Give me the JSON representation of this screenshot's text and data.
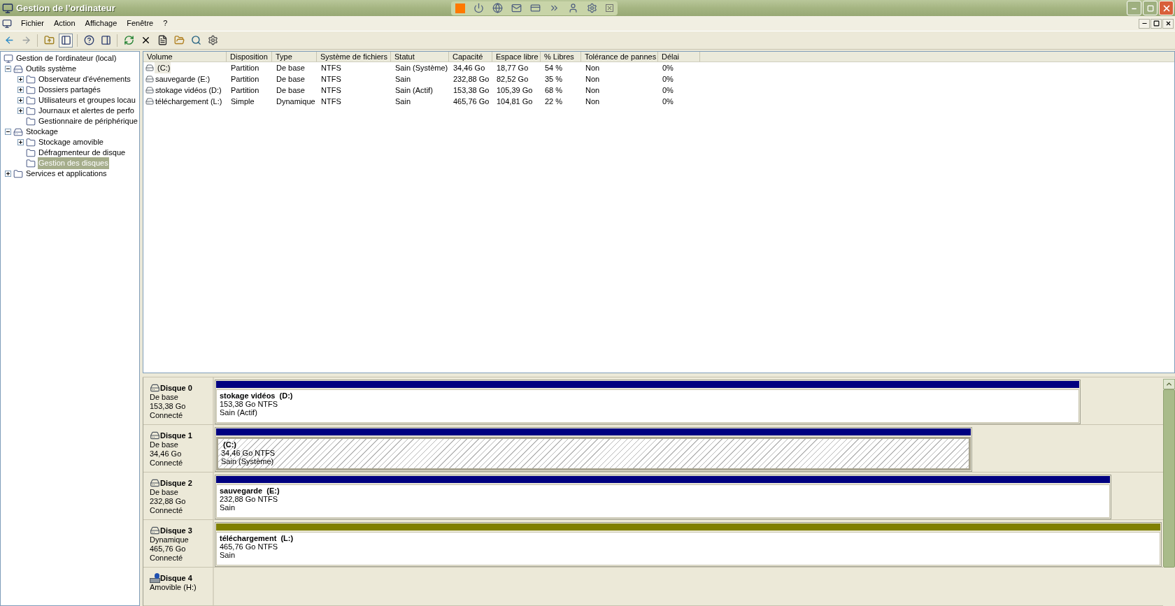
{
  "window": {
    "title": "Gestion de l'ordinateur"
  },
  "menu": [
    "Fichier",
    "Action",
    "Affichage",
    "Fenêtre",
    "?"
  ],
  "tree": [
    {
      "label": "Gestion de l'ordinateur (local)",
      "selected": false,
      "children": [
        {
          "label": "Outils système",
          "expanded": true,
          "selected": false,
          "children": [
            {
              "label": "Observateur d'événements",
              "expanded": false,
              "selected": false
            },
            {
              "label": "Dossiers partagés",
              "expanded": false,
              "selected": false
            },
            {
              "label": "Utilisateurs et groupes locau",
              "expanded": false,
              "selected": false
            },
            {
              "label": "Journaux et alertes de perfo",
              "expanded": false,
              "selected": false
            },
            {
              "label": "Gestionnaire de périphérique",
              "selected": false
            }
          ]
        },
        {
          "label": "Stockage",
          "expanded": true,
          "selected": false,
          "children": [
            {
              "label": "Stockage amovible",
              "expanded": false,
              "selected": false
            },
            {
              "label": "Défragmenteur de disque",
              "selected": false
            },
            {
              "label": "Gestion des disques",
              "selected": true
            }
          ]
        },
        {
          "label": "Services et applications",
          "expanded": false,
          "selected": false
        }
      ]
    }
  ],
  "volumes": {
    "columns": [
      "Volume",
      "Disposition",
      "Type",
      "Système de fichiers",
      "Statut",
      "Capacité",
      "Espace libre",
      "% Libres",
      "Tolérance de pannes",
      "Délai"
    ],
    "rows": [
      {
        "selected": true,
        "cells": [
          " (C:)",
          "Partition",
          "De base",
          "NTFS",
          "Sain (Système)",
          "34,46 Go",
          "18,77 Go",
          "54 %",
          "Non",
          "0%"
        ]
      },
      {
        "selected": false,
        "cells": [
          "sauvegarde (E:)",
          "Partition",
          "De base",
          "NTFS",
          "Sain",
          "232,88 Go",
          "82,52 Go",
          "35 %",
          "Non",
          "0%"
        ]
      },
      {
        "selected": false,
        "cells": [
          "stokage vidéos (D:)",
          "Partition",
          "De base",
          "NTFS",
          "Sain (Actif)",
          "153,38 Go",
          "105,39 Go",
          "68 %",
          "Non",
          "0%"
        ]
      },
      {
        "selected": false,
        "cells": [
          "téléchargement (L:)",
          "Simple",
          "Dynamique",
          "NTFS",
          "Sain",
          "465,76 Go",
          "104,81 Go",
          "22 %",
          "Non",
          "0%"
        ]
      }
    ]
  },
  "disks": [
    {
      "kind": "fixed",
      "name": "Disque 0",
      "type": "De base",
      "size": "153,38 Go",
      "status": "Connecté",
      "partitions": [
        {
          "kind": "basic",
          "selected": false,
          "label": "stokage vidéos  (D:)",
          "detail": "153,38 Go NTFS",
          "status": "Sain (Actif)"
        }
      ]
    },
    {
      "kind": "fixed",
      "name": "Disque 1",
      "type": "De base",
      "size": "34,46 Go",
      "status": "Connecté",
      "partitions": [
        {
          "kind": "basic",
          "selected": true,
          "label": " (C:)",
          "detail": "34,46 Go NTFS",
          "status": "Sain (Système)"
        }
      ]
    },
    {
      "kind": "fixed",
      "name": "Disque 2",
      "type": "De base",
      "size": "232,88 Go",
      "status": "Connecté",
      "partitions": [
        {
          "kind": "basic",
          "selected": false,
          "label": "sauvegarde  (E:)",
          "detail": "232,88 Go NTFS",
          "status": "Sain"
        }
      ]
    },
    {
      "kind": "fixed",
      "name": "Disque 3",
      "type": "Dynamique",
      "size": "465,76 Go",
      "status": "Connecté",
      "partitions": [
        {
          "kind": "dynamic",
          "selected": false,
          "label": "téléchargement  (L:)",
          "detail": "465,76 Go NTFS",
          "status": "Sain"
        }
      ]
    },
    {
      "kind": "removable",
      "name": "Disque 4",
      "type": "Amovible (H:)"
    }
  ]
}
